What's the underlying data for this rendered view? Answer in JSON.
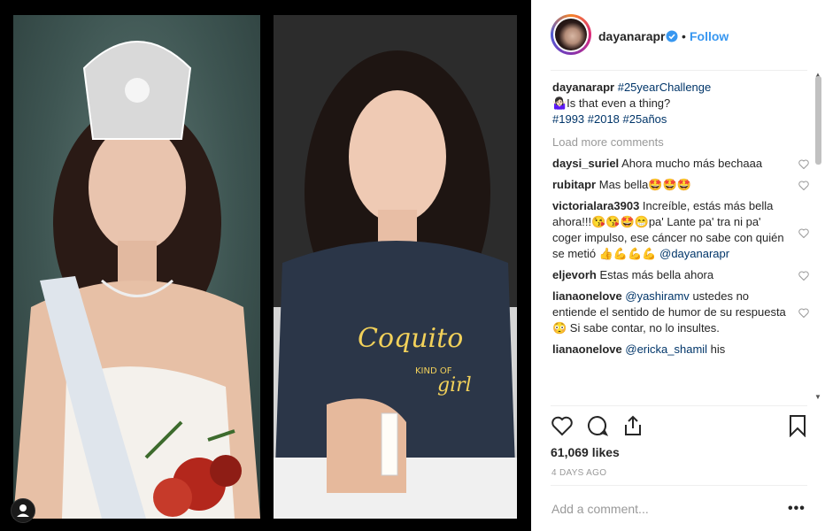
{
  "post": {
    "username": "dayanarapr",
    "follow_label": "Follow",
    "separator": "•",
    "caption": {
      "user": "dayanarapr",
      "tag1": "#25yearChallenge",
      "line2": "🤷🏻‍♀️Is that even a thing?",
      "tags": "#1993 #2018 #25años"
    },
    "load_more": "Load more comments",
    "comments": [
      {
        "user": "daysi_suriel",
        "text": "Ahora mucho más bechaaa"
      },
      {
        "user": "rubitapr",
        "text": "Mas bella🤩🤩🤩"
      },
      {
        "user": "victorialara3903",
        "text": "Increíble, estás más bella ahora!!!😘😘🤩😁pa' Lante pa' tra ni pa' coger impulso, ese cáncer no sabe con quién se metió 👍💪💪💪",
        "mention": "@dayanarapr"
      },
      {
        "user": "eljevorh",
        "text": "Estas más bella ahora"
      },
      {
        "user": "lianaonelove",
        "mention": "@yashiramv",
        "text": "ustedes no entiende el sentido de humor de su respuesta😳 Si sabe contar, no lo insultes."
      },
      {
        "user": "lianaonelove",
        "mention": "@ericka_shamil",
        "text": "his"
      }
    ],
    "likes": "61,069 likes",
    "date": "4 DAYS AGO",
    "add_comment_placeholder": "Add a comment...",
    "more_label": "•••"
  },
  "icons": {
    "heart": "heart-icon",
    "comment": "comment-icon",
    "share": "share-icon",
    "bookmark": "bookmark-icon",
    "verified": "verified-icon"
  },
  "colors": {
    "link": "#3897f0",
    "hashtag": "#003569"
  }
}
